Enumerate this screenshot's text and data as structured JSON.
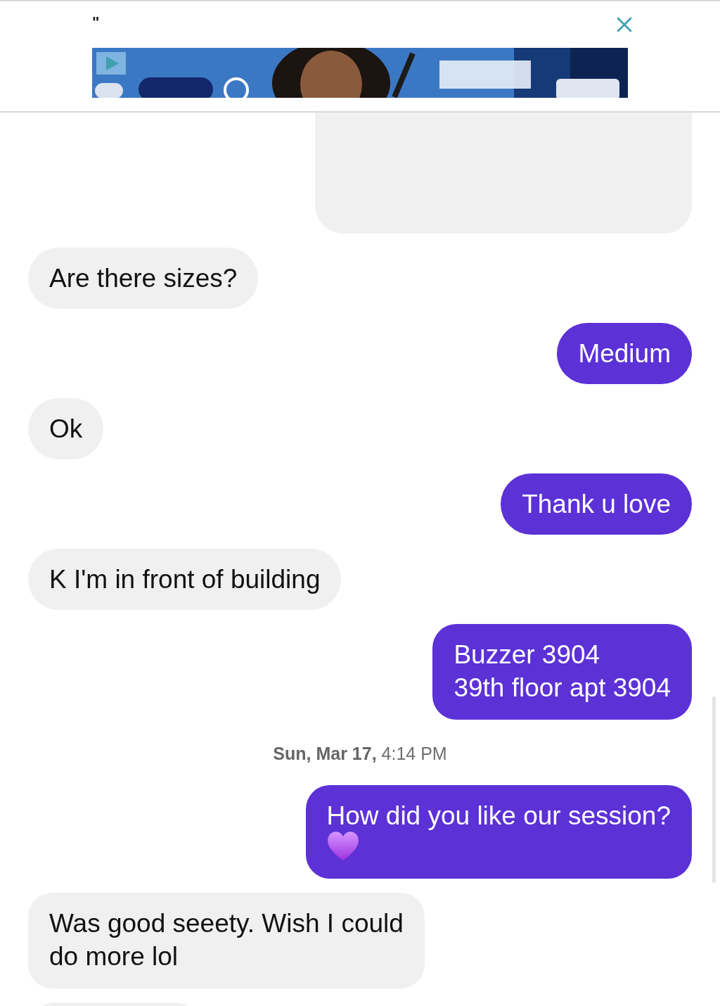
{
  "ad": {
    "label": "\"",
    "kind": "picture"
  },
  "messages": [
    {
      "kind": "sent_partial"
    },
    {
      "kind": "received",
      "text": "Are there sizes?"
    },
    {
      "kind": "sent",
      "text": "Medium"
    },
    {
      "kind": "received",
      "text": "Ok"
    },
    {
      "kind": "sent",
      "text": "Thank u love"
    },
    {
      "kind": "received",
      "text": "K I'm in front of building"
    },
    {
      "kind": "sent",
      "text": "Buzzer 3904\n39th floor apt 3904"
    },
    {
      "kind": "date",
      "text": "**Sun, Mar 17,** 4:14 PM"
    },
    {
      "kind": "sent_heart",
      "text": "How did you like our session?"
    },
    {
      "kind": "received",
      "text": "Was good seeety. Wish I could\ndo more lol"
    },
    {
      "kind": "received_partial"
    }
  ]
}
